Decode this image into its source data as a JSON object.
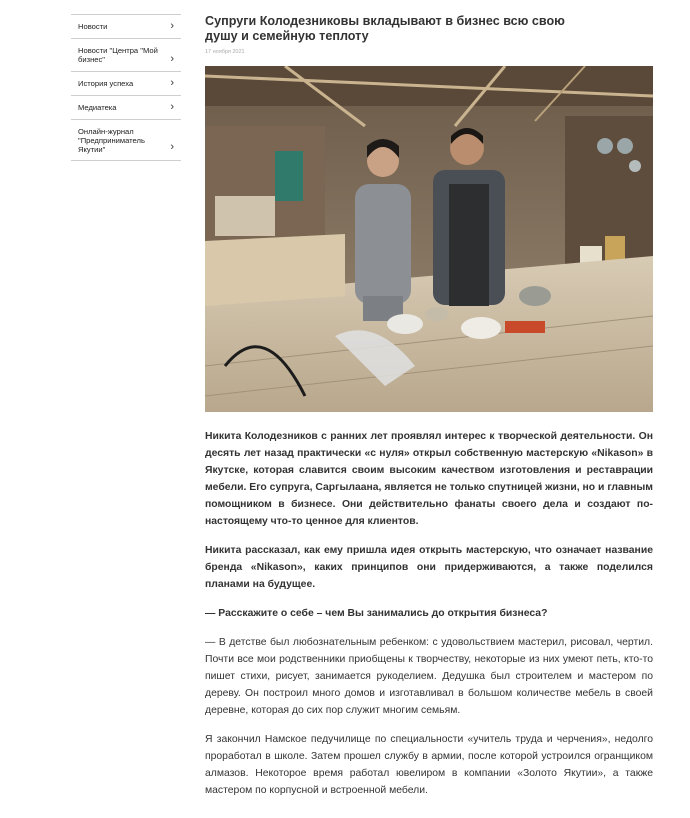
{
  "sidebar": {
    "items": [
      {
        "label": "Новости"
      },
      {
        "label": "Новости \"Центра \"Мой\nбизнес\""
      },
      {
        "label": "История успеха"
      },
      {
        "label": "Медиатека"
      },
      {
        "label": "Онлайн-журнал\n\"Предприниматель\nЯкутии\""
      }
    ]
  },
  "article": {
    "title": "Супруги Колодезниковы вкладывают в бизнес всю свою\nдушу и семейную теплоту",
    "date": "17 ноября 2021",
    "paragraphs": [
      "Никита Колодезников с ранних лет проявлял интерес к творческой деятельности. Он десять лет назад практически «с нуля» открыл собственную мастерскую «Nikason» в Якутске, которая славится своим высоким качеством изготовления и реставрации мебели. Его супруга, Саргылаана, является не только спутницей жизни, но и главным помощником в бизнесе. Они действительно фанаты своего дела и создают по-настоящему что-то ценное для клиентов.",
      "Никита рассказал, как ему пришла идея открыть мастерскую, что означает название бренда «Nikason», каких принципов они придерживаются, а также поделился планами на будущее.",
      "— Расскажите о себе – чем Вы занимались до открытия бизнеса?",
      "— В детстве был любознательным ребенком: с удовольствием мастерил, рисовал, чертил. Почти все мои родственники приобщены к творчеству, некоторые из них умеют петь, кто-то пишет стихи, рисует, занимается рукоделием. Дедушка был строителем и мастером по дереву. Он построил много домов и изготавливал в большом количестве мебель в своей деревне, которая до сих пор служит многим семьям.",
      "Я закончил Намское педучилище по специальности «учитель труда и черчения», недолго проработал в школе. Затем прошел службу в армии, после которой устроился огранщиком алмазов. Некоторое время работал ювелиром в компании «Золото Якутии», а также мастером по корпусной и встроенной мебели."
    ]
  },
  "icons": {
    "chevron": "›",
    "chevron_name": "chevron-right-icon"
  }
}
